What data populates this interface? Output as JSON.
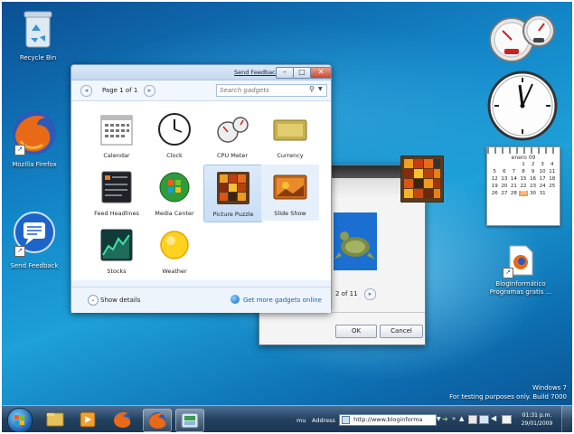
{
  "desktop": {
    "icons": [
      {
        "label": "Recycle Bin"
      },
      {
        "label": "Mozilla Firefox"
      },
      {
        "label": "Send Feedback"
      },
      {
        "label": "BlogInformático Programas gratis ..."
      }
    ],
    "watermark_line1": "Windows 7",
    "watermark_line2": "For testing purposes only. Build 7000"
  },
  "gadget_window": {
    "send_feedback": "Send Feedback",
    "page_indicator": "Page 1 of 1",
    "search_placeholder": "Search gadgets",
    "gadgets": [
      {
        "label": "Calendar"
      },
      {
        "label": "Clock"
      },
      {
        "label": "CPU Meter"
      },
      {
        "label": "Currency"
      },
      {
        "label": "Feed Headlines"
      },
      {
        "label": "Media Center"
      },
      {
        "label": "Picture Puzzle",
        "selected": true
      },
      {
        "label": "Slide Show"
      },
      {
        "label": "Stocks"
      },
      {
        "label": "Weather"
      }
    ],
    "show_details": "Show details",
    "get_more": "Get more gadgets online"
  },
  "slide_dialog": {
    "page_counter": "2 of 11",
    "ok_label": "OK",
    "cancel_label": "Cancel"
  },
  "sidebar_gadgets": {
    "calendar_month": "enero 09",
    "calendar_days": [
      "1",
      "2",
      "3",
      "4",
      "5",
      "6",
      "7",
      "8",
      "9",
      "10",
      "11",
      "12",
      "13",
      "14",
      "15",
      "16",
      "17",
      "18",
      "19",
      "20",
      "21",
      "22",
      "23",
      "24",
      "25",
      "26",
      "27",
      "28",
      "29",
      "30",
      "31"
    ],
    "calendar_today": "29"
  },
  "taskbar": {
    "toolbar_label": "mu",
    "address_label": "Address",
    "address_value": "http://www.bloginforma",
    "clock_time": "01:31 p.m.",
    "clock_date": "29/01/2009"
  },
  "colors": {
    "accent": "#1e9ad6",
    "link": "#1a5fb4"
  }
}
